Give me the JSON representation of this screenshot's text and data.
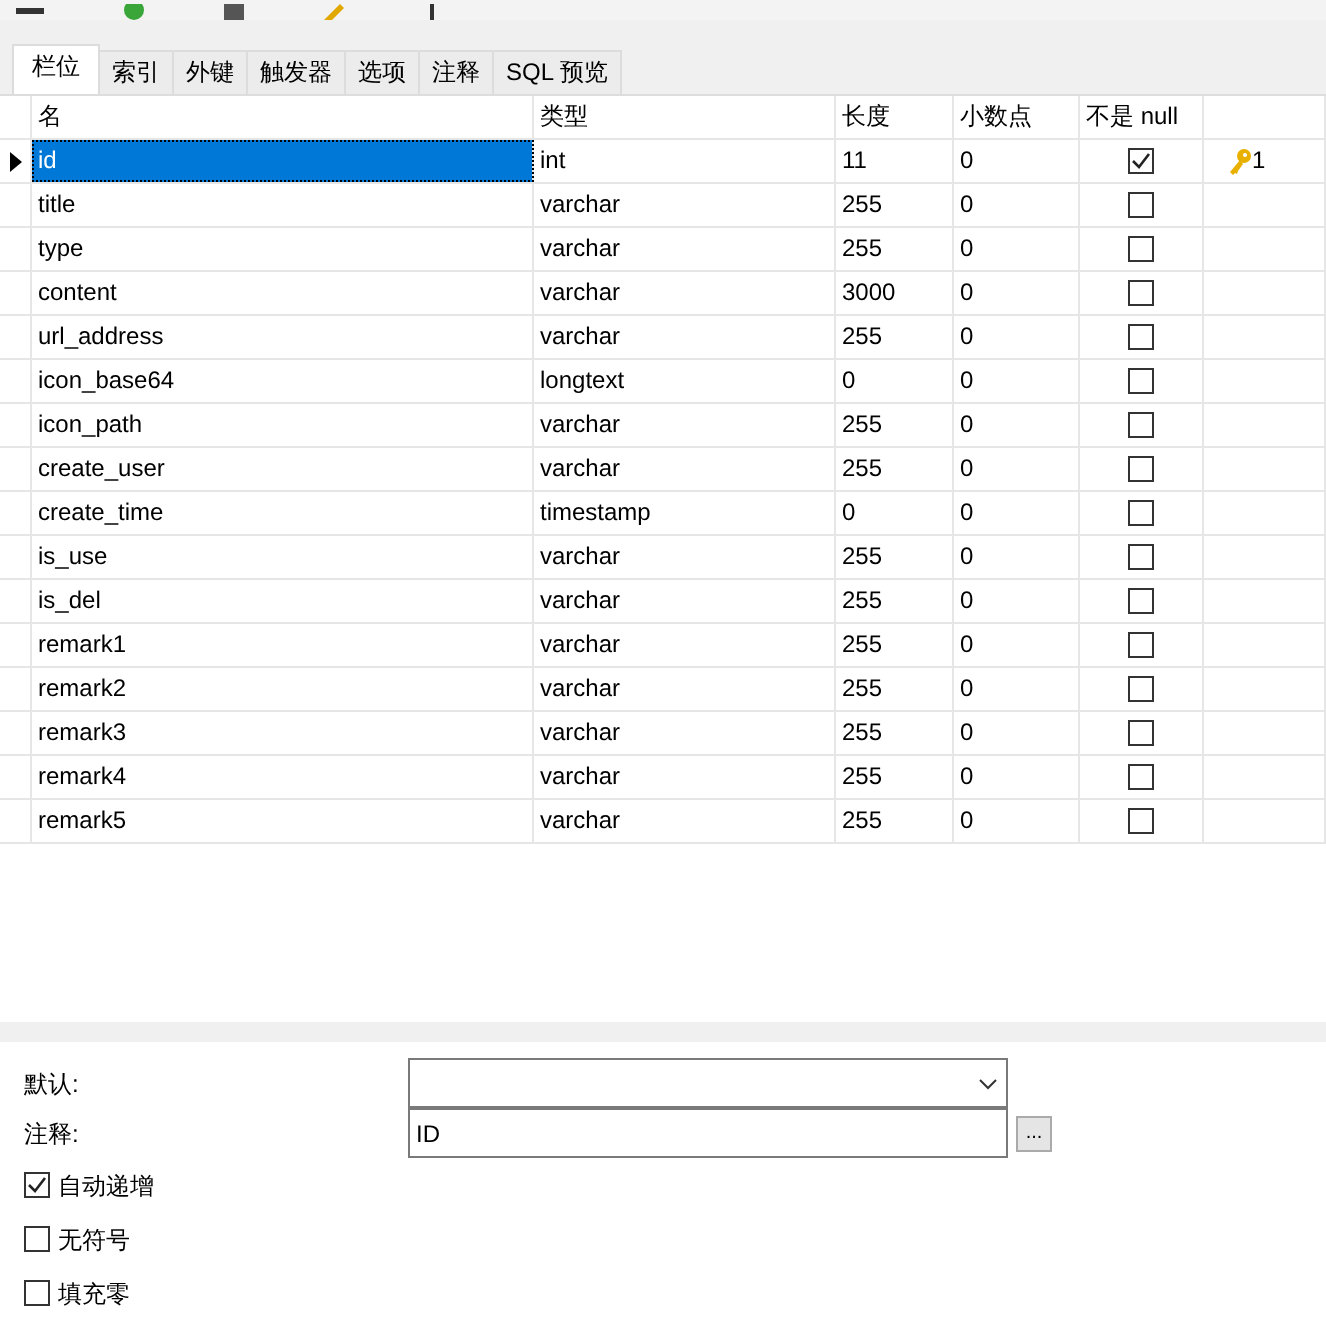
{
  "tabs": [
    {
      "label": "栏位",
      "selected": true
    },
    {
      "label": "索引",
      "selected": false
    },
    {
      "label": "外键",
      "selected": false
    },
    {
      "label": "触发器",
      "selected": false
    },
    {
      "label": "选项",
      "selected": false
    },
    {
      "label": "注释",
      "selected": false
    },
    {
      "label": "SQL 预览",
      "selected": false
    }
  ],
  "table": {
    "columns": [
      "名",
      "类型",
      "长度",
      "小数点",
      "不是 null"
    ],
    "rows": [
      {
        "name": "id",
        "type": "int",
        "length": "11",
        "decimals": "0",
        "not_null": true,
        "key": "1",
        "selected": true
      },
      {
        "name": "title",
        "type": "varchar",
        "length": "255",
        "decimals": "0",
        "not_null": false,
        "selected": false
      },
      {
        "name": "type",
        "type": "varchar",
        "length": "255",
        "decimals": "0",
        "not_null": false,
        "selected": false
      },
      {
        "name": "content",
        "type": "varchar",
        "length": "3000",
        "decimals": "0",
        "not_null": false,
        "selected": false
      },
      {
        "name": "url_address",
        "type": "varchar",
        "length": "255",
        "decimals": "0",
        "not_null": false,
        "selected": false
      },
      {
        "name": "icon_base64",
        "type": "longtext",
        "length": "0",
        "decimals": "0",
        "not_null": false,
        "selected": false
      },
      {
        "name": "icon_path",
        "type": "varchar",
        "length": "255",
        "decimals": "0",
        "not_null": false,
        "selected": false
      },
      {
        "name": "create_user",
        "type": "varchar",
        "length": "255",
        "decimals": "0",
        "not_null": false,
        "selected": false
      },
      {
        "name": "create_time",
        "type": "timestamp",
        "length": "0",
        "decimals": "0",
        "not_null": false,
        "selected": false
      },
      {
        "name": "is_use",
        "type": "varchar",
        "length": "255",
        "decimals": "0",
        "not_null": false,
        "selected": false
      },
      {
        "name": "is_del",
        "type": "varchar",
        "length": "255",
        "decimals": "0",
        "not_null": false,
        "selected": false
      },
      {
        "name": "remark1",
        "type": "varchar",
        "length": "255",
        "decimals": "0",
        "not_null": false,
        "selected": false
      },
      {
        "name": "remark2",
        "type": "varchar",
        "length": "255",
        "decimals": "0",
        "not_null": false,
        "selected": false
      },
      {
        "name": "remark3",
        "type": "varchar",
        "length": "255",
        "decimals": "0",
        "not_null": false,
        "selected": false
      },
      {
        "name": "remark4",
        "type": "varchar",
        "length": "255",
        "decimals": "0",
        "not_null": false,
        "selected": false
      },
      {
        "name": "remark5",
        "type": "varchar",
        "length": "255",
        "decimals": "0",
        "not_null": false,
        "selected": false
      }
    ]
  },
  "properties": {
    "default_label": "默认:",
    "comment_label": "注释:",
    "comment_value": "ID",
    "browse_button": "...",
    "options": [
      {
        "label": "自动递增",
        "checked": true
      },
      {
        "label": "无符号",
        "checked": false
      },
      {
        "label": "填充零",
        "checked": false
      }
    ]
  }
}
